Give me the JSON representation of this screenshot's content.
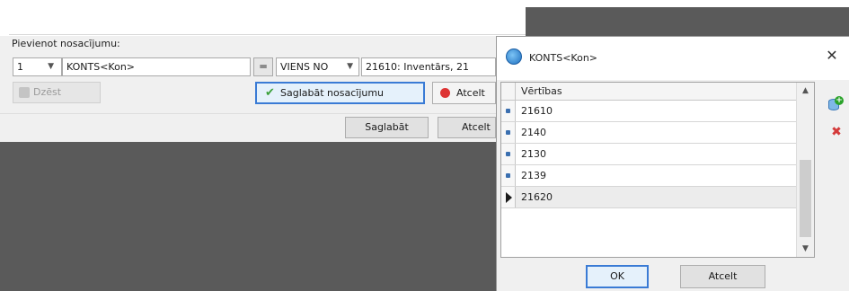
{
  "form": {
    "label": "Pievienot nosacījumu:",
    "index_value": "1",
    "field_value": "KONTS<Kon>",
    "equals_symbol": "═",
    "operator_value": "VIENS NO",
    "value_text": "21610: Inventārs, 21",
    "delete_label": "Dzēst",
    "save_condition_label": "Saglabāt nosacījumu",
    "cancel_condition_label": "Atcelt"
  },
  "footer": {
    "save_label": "Saglabāt",
    "cancel_label": "Atcelt"
  },
  "dialog": {
    "title": "KONTS<Kon>",
    "close_symbol": "✕",
    "column_header": "Vērtības",
    "rows": [
      "21610",
      "2140",
      "2130",
      "2139",
      "21620"
    ],
    "ok_label": "OK",
    "cancel_label": "Atcelt",
    "icons": {
      "app": "app-logo-icon",
      "add": "database-add-icon",
      "delete": "delete-icon"
    }
  },
  "colors": {
    "accent": "#3a7bd5",
    "dark_background": "#5a5a5a",
    "panel": "#f0f0f0"
  }
}
